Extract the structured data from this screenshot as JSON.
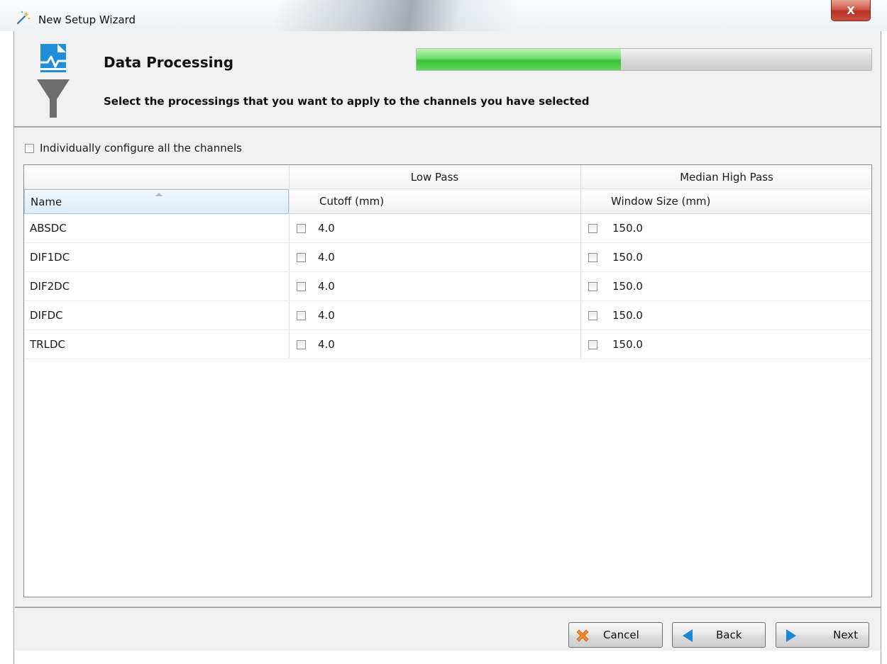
{
  "window": {
    "title": "New Setup Wizard",
    "icon": "magic-wand-icon",
    "close_label": "X"
  },
  "header": {
    "title": "Data Processing",
    "subtitle": "Select the processings that you want to apply to the channels you have selected",
    "icon": "data-filter-funnel-icon",
    "progress": 0.45
  },
  "options": {
    "individual_config_label": "Individually configure all the channels",
    "individual_config_checked": false
  },
  "table": {
    "group_headers": [
      "",
      "Low Pass",
      "Median High Pass"
    ],
    "columns": {
      "name": "Name",
      "lowpass_enabled": "",
      "cutoff": "Cutoff (mm)",
      "highpass_enabled": "",
      "window_size": "Window Size (mm)"
    },
    "sorted_column": "Name",
    "rows": [
      {
        "name": "ABSDC",
        "lowpass": false,
        "cutoff": "4.0",
        "highpass": false,
        "window_size": "150.0"
      },
      {
        "name": "DIF1DC",
        "lowpass": false,
        "cutoff": "4.0",
        "highpass": false,
        "window_size": "150.0"
      },
      {
        "name": "DIF2DC",
        "lowpass": false,
        "cutoff": "4.0",
        "highpass": false,
        "window_size": "150.0"
      },
      {
        "name": "DIFDC",
        "lowpass": false,
        "cutoff": "4.0",
        "highpass": false,
        "window_size": "150.0"
      },
      {
        "name": "TRLDC",
        "lowpass": false,
        "cutoff": "4.0",
        "highpass": false,
        "window_size": "150.0"
      }
    ]
  },
  "footer": {
    "cancel_label": "Cancel",
    "back_label": "Back",
    "next_label": "Next"
  },
  "colors": {
    "progress_green": "#4fd04c",
    "cancel_icon": "#f08a2a",
    "nav_icon": "#1a86d6",
    "header_icon_blue": "#1e8fd8",
    "header_icon_gray": "#6d6d6d"
  }
}
